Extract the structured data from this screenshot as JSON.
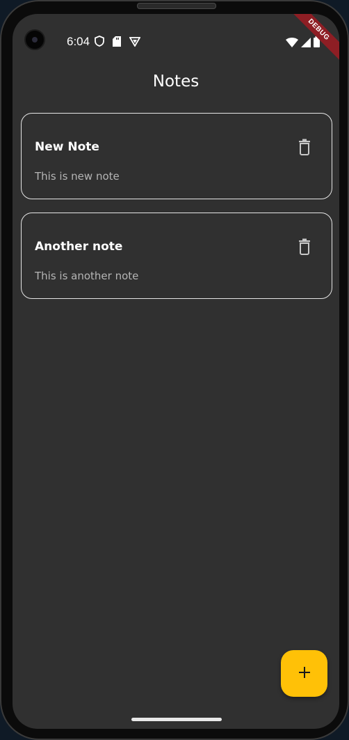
{
  "status_bar": {
    "time": "6:04",
    "left_icons": [
      "shield-icon",
      "sd-card-icon",
      "vpn-icon"
    ],
    "right_icons": [
      "wifi-icon",
      "signal-icon",
      "battery-icon"
    ],
    "debug_label": "DEBUG"
  },
  "app_bar": {
    "title": "Notes"
  },
  "notes": [
    {
      "title": "New Note",
      "body": "This is new note",
      "action_icon": "delete-icon"
    },
    {
      "title": "Another note",
      "body": "This is another note",
      "action_icon": "delete-icon"
    }
  ],
  "fab": {
    "icon": "plus-icon",
    "color": "#ffc107"
  },
  "colors": {
    "background": "#303030",
    "card_border": "#e6e6e6",
    "accent": "#ffc107",
    "debug_banner": "#8e1e24"
  }
}
